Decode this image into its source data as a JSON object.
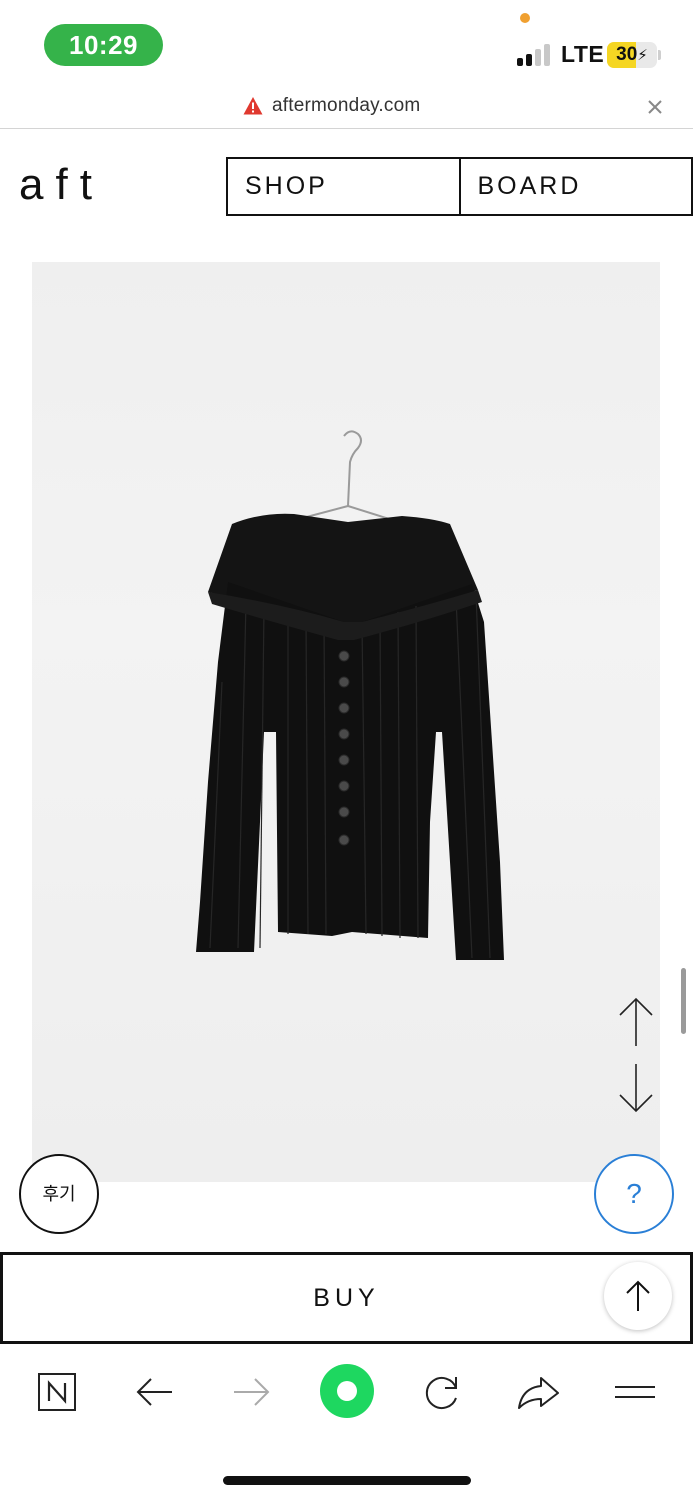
{
  "status_bar": {
    "time": "10:29",
    "network": "LTE",
    "battery_level": "30",
    "battery_fraction": 0.3,
    "colors": {
      "time_pill": "#35b34a",
      "battery_fill": "#f5d623",
      "mic_dot": "#f0a030"
    }
  },
  "browser": {
    "url": "aftermonday.com",
    "warning_icon": "warning-icon",
    "close_icon": "close-icon"
  },
  "site": {
    "logo": "aft",
    "nav": [
      {
        "label": "SHOP"
      },
      {
        "label": "BOARD"
      }
    ]
  },
  "product": {
    "image_icon": "product-photo"
  },
  "floating": {
    "review_label": "후기",
    "help_label": "?",
    "help_color": "#2a7fd6"
  },
  "buy": {
    "label": "BUY"
  },
  "toolbar": {
    "items": [
      "naver-icon",
      "back-arrow-icon",
      "forward-arrow-icon",
      "green-circle-icon",
      "reload-icon",
      "share-icon",
      "menu-icon"
    ],
    "accent": "#1ed760"
  }
}
